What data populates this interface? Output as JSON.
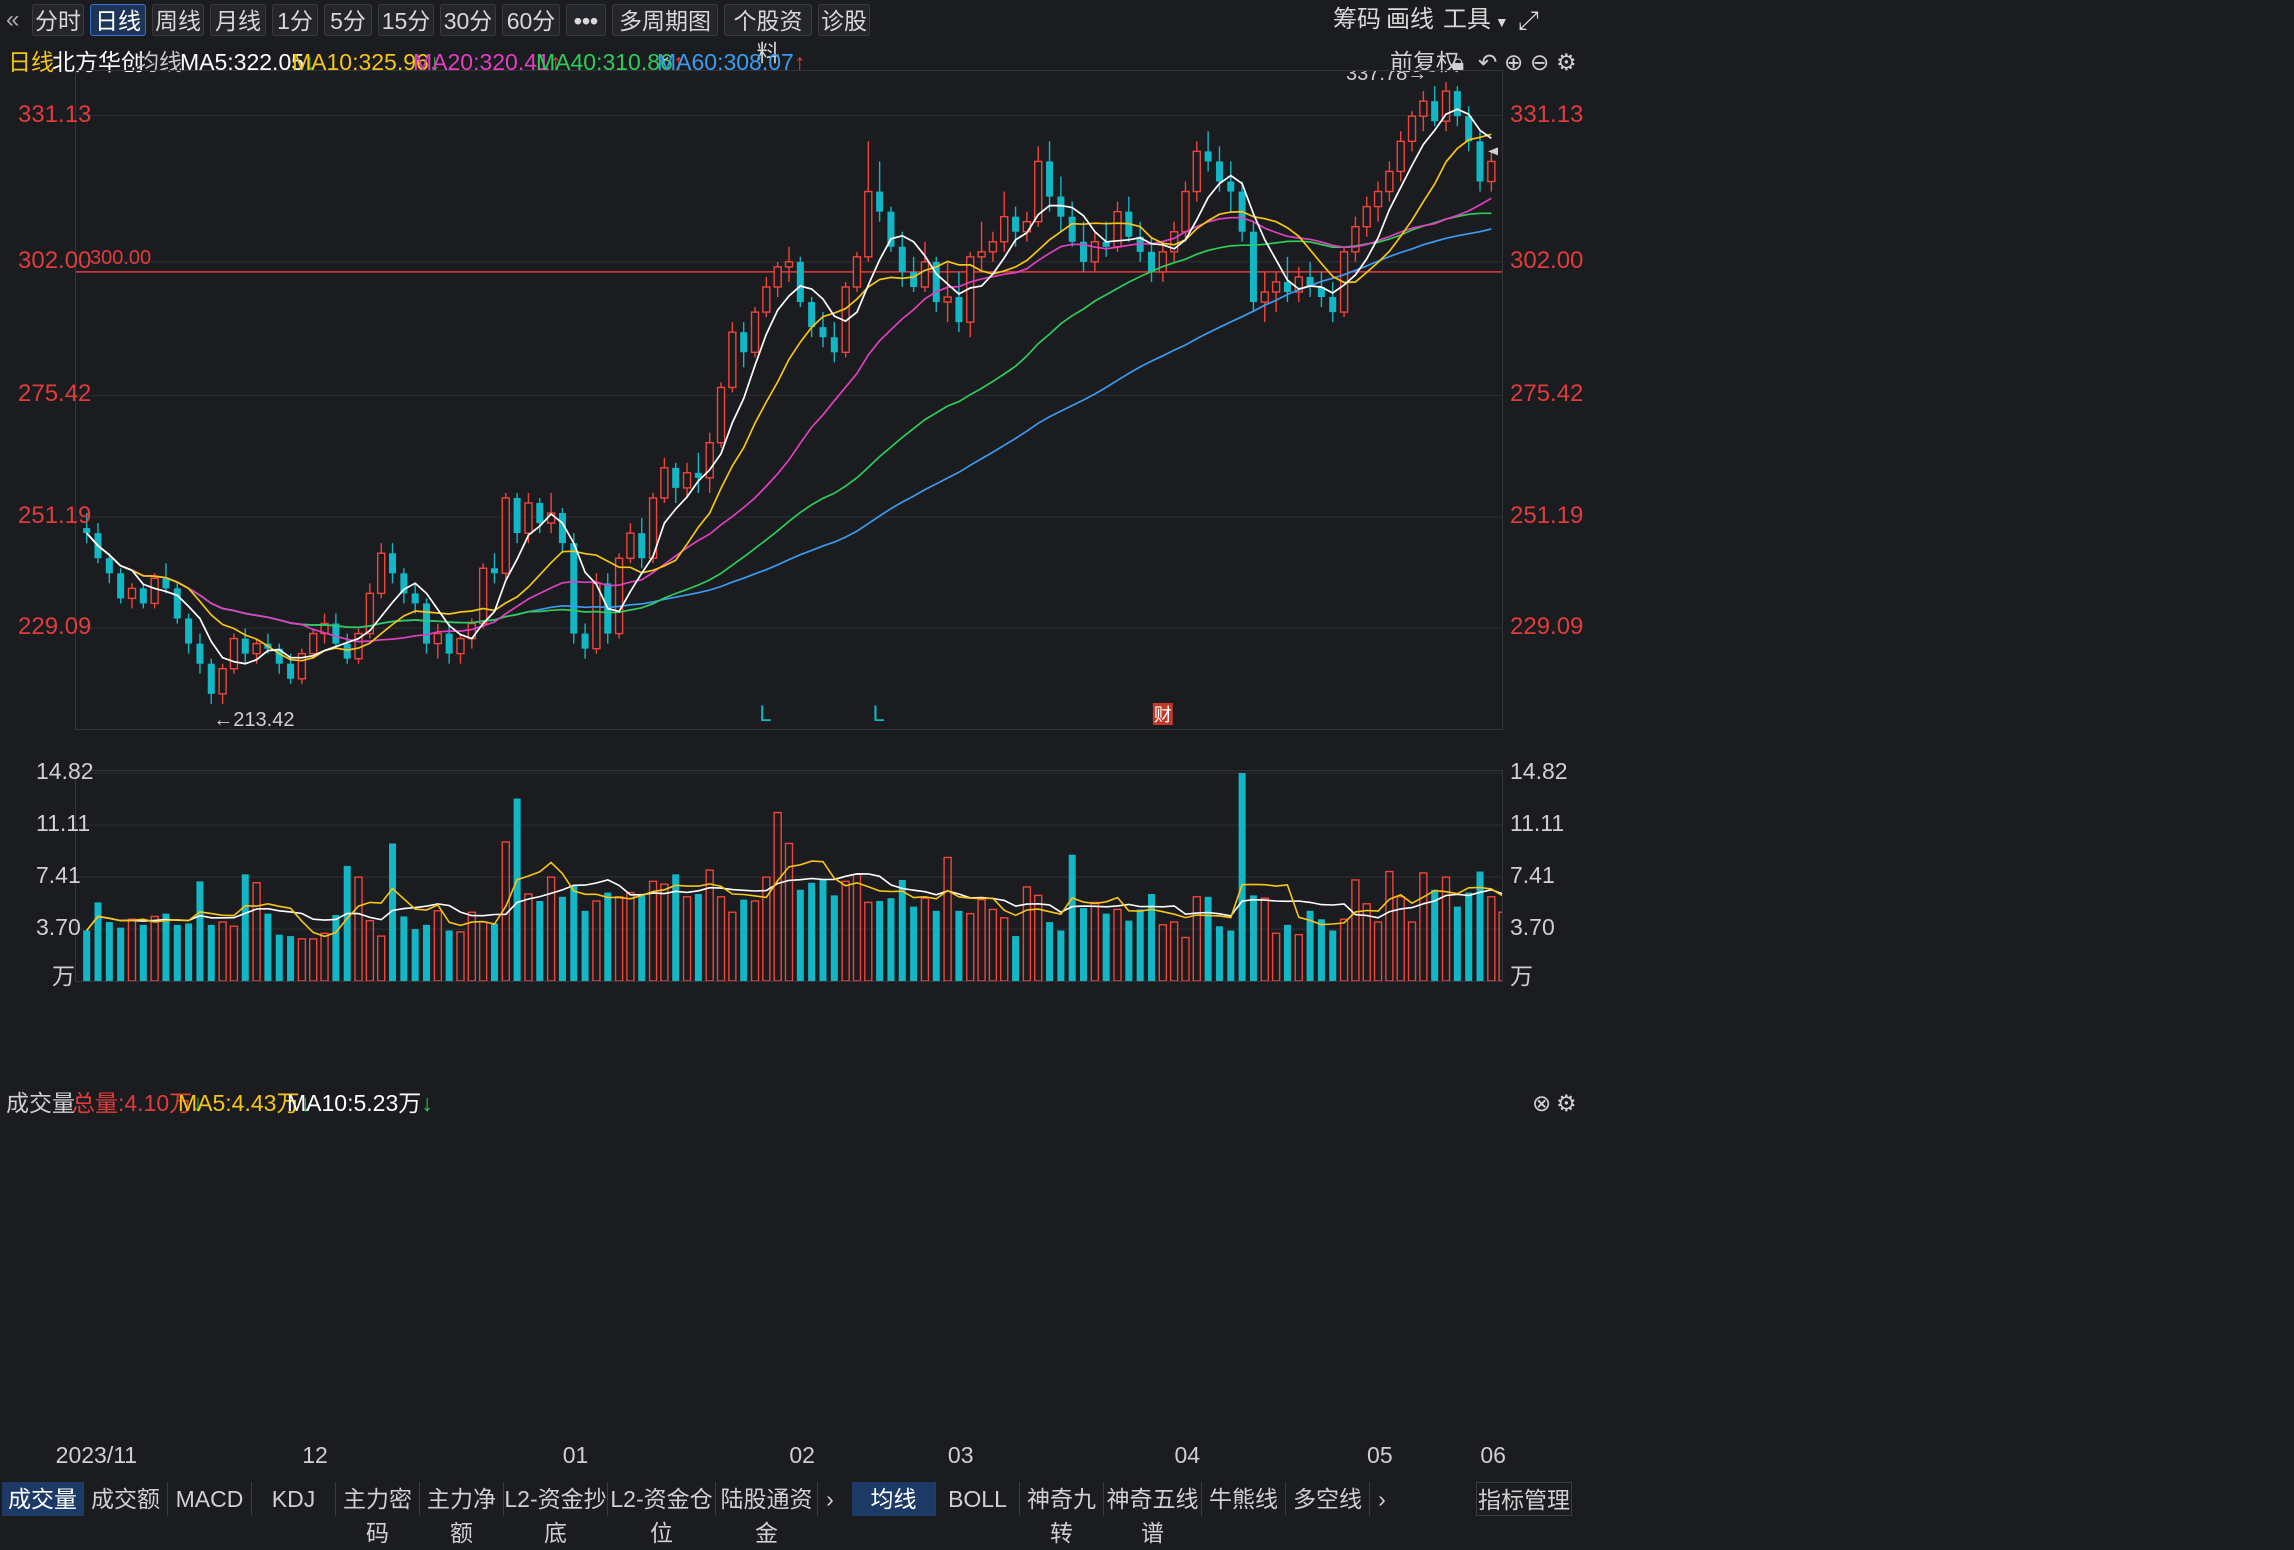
{
  "toolbar": {
    "back_icon": "«",
    "periods": [
      "分时",
      "日线",
      "周线",
      "月线",
      "1分",
      "5分",
      "15分",
      "30分",
      "60分"
    ],
    "active": "日线",
    "more": "•••",
    "multi": "多周期图",
    "profile": "个股资料",
    "diagnose": "诊股",
    "chips": "筹码",
    "draw": "画线",
    "tools": "工具",
    "expand_icon": "expand-icon"
  },
  "ma_bar": {
    "period": "日线",
    "stock": "北方华创",
    "avg": "均线",
    "ma5": "MA5:322.05",
    "ma10": "MA10:325.96",
    "ma20": "MA20:320.41",
    "ma40": "MA40:310.86",
    "ma60": "MA60:308.07",
    "adjust": "前复权",
    "colors": {
      "ma5": "#ffffff",
      "ma10": "#f5c518",
      "ma20": "#e040c0",
      "ma40": "#2ecc5a",
      "ma60": "#3a9bf0"
    }
  },
  "volume_bar": {
    "title": "成交量",
    "total": "总量:4.10万",
    "ma5": "MA5:4.43万",
    "ma10": "MA10:5.23万"
  },
  "chart_data": [
    {
      "type": "candlestick",
      "title": "北方华创 日线",
      "y_ticks": [
        "331.13",
        "302.00",
        "275.42",
        "251.19",
        "229.09"
      ],
      "ylim": [
        209,
        340
      ],
      "reference_line": {
        "value": 300,
        "label": "300.00"
      },
      "high_label": "337.78→",
      "low_label": "←213.42",
      "markers": [
        "L",
        "L",
        "财"
      ],
      "x_ticks": [
        "2023/11",
        "12",
        "01",
        "02",
        "03",
        "04",
        "05",
        "06"
      ],
      "ohlc": [
        [
          249,
          252,
          246,
          248
        ],
        [
          248,
          250,
          242,
          243
        ],
        [
          243,
          244,
          238,
          240
        ],
        [
          240,
          241,
          234,
          235
        ],
        [
          235,
          238,
          233,
          237
        ],
        [
          237,
          238,
          233,
          234
        ],
        [
          234,
          240,
          233,
          239
        ],
        [
          239,
          242,
          236,
          237
        ],
        [
          237,
          238,
          230,
          231
        ],
        [
          231,
          232,
          224,
          226
        ],
        [
          226,
          228,
          220,
          222
        ],
        [
          222,
          223,
          214,
          216
        ],
        [
          216,
          222,
          214,
          221
        ],
        [
          221,
          228,
          220,
          227
        ],
        [
          227,
          229,
          222,
          224
        ],
        [
          224,
          227,
          222,
          226
        ],
        [
          226,
          228,
          224,
          225
        ],
        [
          225,
          226,
          220,
          222
        ],
        [
          222,
          224,
          218,
          219
        ],
        [
          219,
          225,
          218,
          224
        ],
        [
          224,
          229,
          223,
          228
        ],
        [
          228,
          232,
          226,
          230
        ],
        [
          230,
          232,
          225,
          226
        ],
        [
          226,
          228,
          222,
          223
        ],
        [
          223,
          229,
          222,
          228
        ],
        [
          228,
          238,
          227,
          236
        ],
        [
          236,
          246,
          235,
          244
        ],
        [
          244,
          246,
          238,
          240
        ],
        [
          240,
          241,
          234,
          236
        ],
        [
          236,
          238,
          232,
          234
        ],
        [
          234,
          235,
          224,
          226
        ],
        [
          226,
          230,
          223,
          228
        ],
        [
          228,
          230,
          222,
          224
        ],
        [
          224,
          228,
          222,
          227
        ],
        [
          227,
          231,
          225,
          230
        ],
        [
          230,
          242,
          229,
          241
        ],
        [
          241,
          244,
          238,
          240
        ],
        [
          240,
          256,
          239,
          255
        ],
        [
          255,
          256,
          246,
          248
        ],
        [
          248,
          256,
          246,
          254
        ],
        [
          254,
          255,
          248,
          250
        ],
        [
          250,
          256,
          248,
          252
        ],
        [
          252,
          253,
          244,
          246
        ],
        [
          246,
          248,
          226,
          228
        ],
        [
          228,
          230,
          223,
          225
        ],
        [
          225,
          240,
          224,
          238
        ],
        [
          238,
          240,
          226,
          228
        ],
        [
          228,
          244,
          227,
          243
        ],
        [
          243,
          250,
          242,
          248
        ],
        [
          248,
          251,
          241,
          243
        ],
        [
          243,
          256,
          242,
          255
        ],
        [
          255,
          263,
          254,
          261
        ],
        [
          261,
          262,
          254,
          257
        ],
        [
          257,
          262,
          255,
          260
        ],
        [
          260,
          264,
          256,
          259
        ],
        [
          259,
          268,
          256,
          266
        ],
        [
          266,
          278,
          265,
          277
        ],
        [
          277,
          290,
          276,
          288
        ],
        [
          288,
          290,
          281,
          284
        ],
        [
          284,
          293,
          283,
          292
        ],
        [
          292,
          299,
          291,
          297
        ],
        [
          297,
          302,
          295,
          301
        ],
        [
          301,
          305,
          298,
          302
        ],
        [
          302,
          303,
          293,
          294
        ],
        [
          294,
          295,
          287,
          289
        ],
        [
          289,
          292,
          285,
          287
        ],
        [
          287,
          290,
          282,
          284
        ],
        [
          284,
          298,
          283,
          297
        ],
        [
          297,
          304,
          296,
          303
        ],
        [
          303,
          326,
          302,
          316
        ],
        [
          316,
          322,
          310,
          312
        ],
        [
          312,
          313,
          304,
          305
        ],
        [
          305,
          308,
          297,
          300
        ],
        [
          300,
          303,
          296,
          297
        ],
        [
          297,
          306,
          296,
          302
        ],
        [
          302,
          303,
          292,
          294
        ],
        [
          294,
          302,
          290,
          295
        ],
        [
          295,
          300,
          288,
          290
        ],
        [
          290,
          304,
          287,
          303
        ],
        [
          303,
          310,
          300,
          304
        ],
        [
          304,
          308,
          302,
          306
        ],
        [
          306,
          316,
          304,
          311
        ],
        [
          311,
          313,
          305,
          308
        ],
        [
          308,
          312,
          306,
          310
        ],
        [
          310,
          325,
          309,
          322
        ],
        [
          322,
          326,
          312,
          315
        ],
        [
          315,
          319,
          308,
          311
        ],
        [
          311,
          314,
          305,
          306
        ],
        [
          306,
          310,
          300,
          302
        ],
        [
          302,
          308,
          300,
          306
        ],
        [
          306,
          310,
          303,
          305
        ],
        [
          305,
          314,
          304,
          312
        ],
        [
          312,
          315,
          306,
          307
        ],
        [
          307,
          310,
          302,
          304
        ],
        [
          304,
          307,
          298,
          300
        ],
        [
          300,
          306,
          298,
          304
        ],
        [
          304,
          310,
          302,
          308
        ],
        [
          308,
          318,
          306,
          316
        ],
        [
          316,
          326,
          314,
          324
        ],
        [
          324,
          328,
          320,
          322
        ],
        [
          322,
          325,
          316,
          318
        ],
        [
          318,
          322,
          312,
          316
        ],
        [
          316,
          318,
          306,
          308
        ],
        [
          308,
          310,
          292,
          294
        ],
        [
          294,
          300,
          290,
          296
        ],
        [
          296,
          300,
          292,
          298
        ],
        [
          298,
          303,
          294,
          296
        ],
        [
          296,
          301,
          294,
          299
        ],
        [
          299,
          302,
          295,
          297
        ],
        [
          297,
          300,
          293,
          295
        ],
        [
          295,
          298,
          290,
          292
        ],
        [
          292,
          305,
          291,
          304
        ],
        [
          304,
          311,
          302,
          309
        ],
        [
          309,
          315,
          307,
          313
        ],
        [
          313,
          318,
          310,
          316
        ],
        [
          316,
          322,
          314,
          320
        ],
        [
          320,
          328,
          318,
          326
        ],
        [
          326,
          332,
          324,
          331
        ],
        [
          331,
          336,
          328,
          334
        ],
        [
          334,
          337,
          329,
          330
        ],
        [
          330,
          337.78,
          328,
          336
        ],
        [
          336,
          337,
          329,
          331
        ],
        [
          331,
          333,
          324,
          326
        ],
        [
          326,
          328,
          316,
          318
        ],
        [
          318,
          324,
          316,
          322
        ]
      ]
    },
    {
      "type": "bar",
      "title": "成交量",
      "unit": "万",
      "y_ticks": [
        "14.82",
        "11.11",
        "7.41",
        "3.70"
      ],
      "ylim": [
        0,
        14.82
      ],
      "values": [
        3.6,
        5.6,
        4.2,
        3.8,
        4.4,
        4.0,
        4.6,
        4.8,
        4.0,
        4.1,
        7.1,
        4.0,
        4.2,
        3.9,
        7.6,
        7.0,
        4.8,
        3.3,
        3.2,
        3.0,
        3.0,
        3.4,
        4.7,
        8.2,
        7.4,
        4.3,
        3.2,
        9.8,
        4.6,
        3.7,
        4.0,
        5.0,
        3.6,
        3.5,
        4.9,
        4.2,
        4.1,
        9.9,
        13.0,
        6.2,
        5.7,
        7.4,
        6.0,
        6.8,
        5.0,
        5.7,
        6.3,
        6.0,
        6.3,
        6.2,
        7.1,
        6.9,
        7.6,
        6.0,
        6.2,
        7.9,
        6.0,
        4.9,
        5.8,
        5.7,
        7.4,
        12.0,
        9.8,
        6.5,
        7.0,
        7.2,
        6.1,
        7.1,
        7.6,
        5.6,
        5.7,
        5.9,
        7.2,
        5.3,
        5.9,
        5.0,
        8.8,
        5.0,
        4.8,
        5.8,
        5.1,
        4.5,
        3.2,
        6.7,
        6.1,
        4.2,
        3.6,
        9.0,
        5.2,
        5.6,
        4.8,
        5.1,
        4.3,
        5.1,
        6.2,
        4.0,
        4.2,
        3.1,
        6.0,
        6.0,
        3.9,
        3.6,
        14.82,
        6.1,
        5.9,
        3.4,
        4.0,
        3.3,
        5.0,
        4.4,
        3.6,
        4.4,
        7.2,
        5.5,
        4.2,
        7.8,
        6.0,
        4.2,
        7.7,
        6.5,
        7.4,
        5.3,
        6.3,
        7.8,
        6.0,
        4.9,
        5.9,
        5.2,
        3.9,
        5.5,
        4.1
      ]
    }
  ],
  "bottom_tabs": {
    "left": [
      "成交量",
      "成交额",
      "MACD",
      "KDJ",
      "主力密码",
      "主力净额",
      "L2-资金抄底",
      "L2-资金仓位",
      "陆股通资金"
    ],
    "right": [
      "均线",
      "BOLL",
      "神奇九转",
      "神奇五线谱",
      "牛熊线",
      "多空线"
    ],
    "manage": "指标管理"
  }
}
